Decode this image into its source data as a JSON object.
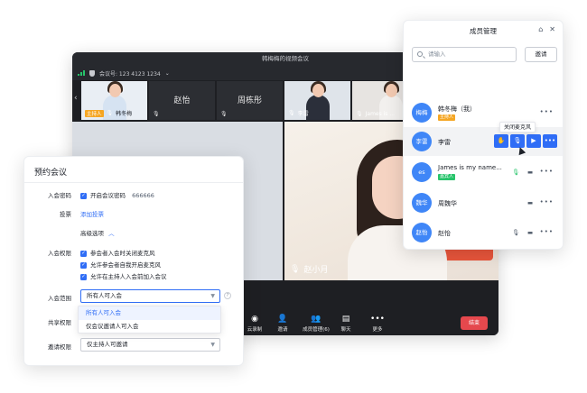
{
  "meeting": {
    "title": "韩梅梅的视频会议",
    "meeting_id": "会议号: 123 4123 1234",
    "thumbnails": [
      {
        "name": "韩冬梅",
        "tag": "主持人"
      },
      {
        "name": "赵怡"
      },
      {
        "name": "周栋彤"
      },
      {
        "name": "李雷"
      },
      {
        "name": "James is ..."
      }
    ],
    "main_speaker": "赵小月",
    "toolbar": [
      {
        "label": "云录制",
        "icon": "record-icon"
      },
      {
        "label": "邀请",
        "icon": "invite-icon"
      },
      {
        "label": "成员管理(6)",
        "icon": "members-icon"
      },
      {
        "label": "聊天",
        "icon": "chat-icon"
      },
      {
        "label": "更多",
        "icon": "more-icon"
      }
    ],
    "end_button": "结束"
  },
  "schedule": {
    "title": "预约会议",
    "password_label": "入会密码",
    "password_text": "开启会议密码",
    "password_value": "666666",
    "vote_label": "投票",
    "vote_link": "添加投票",
    "advanced": "高级选项",
    "permission_label": "入会权限",
    "permissions": [
      "参会者入会时关闭麦克风",
      "允许参会者自我开启麦克风",
      "允许在主持人入会前加入会议"
    ],
    "scope_label": "入会范围",
    "scope_value": "所有人可入会",
    "scope_options": [
      "所有人可入会",
      "仅会议邀请人可入会"
    ],
    "share_label": "共享权限",
    "invite_perm_label": "邀请权限",
    "invite_perm_value": "仅主持人可邀请"
  },
  "members": {
    "title": "成员管理",
    "search_placeholder": "请输入",
    "invite_button": "邀请",
    "tooltip": "关闭麦克风",
    "list": [
      {
        "avatar": "梅梅",
        "name": "韩冬梅（我）",
        "badge": "主持人"
      },
      {
        "avatar": "李雷",
        "name": "李雷"
      },
      {
        "avatar": "es",
        "name": "James is my name...",
        "badge": "嘉宾人"
      },
      {
        "avatar": "魏华",
        "name": "周魏华"
      },
      {
        "avatar": "赵怡",
        "name": "赵怡"
      }
    ]
  },
  "colors": {
    "accent": "#2f6df6",
    "danger": "#e5484d",
    "host_badge": "#f5a623",
    "guest_badge": "#27c46b"
  }
}
